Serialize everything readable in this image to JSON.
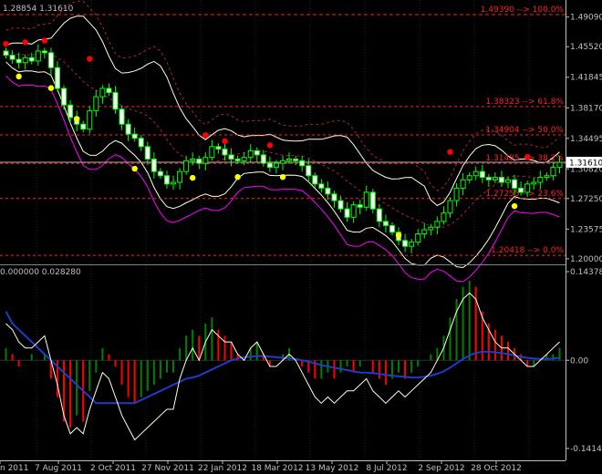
{
  "chart_data": [
    {
      "type": "candlestick",
      "panel": "price",
      "header": "1.28854 1.31610",
      "yticks": [
        "1.49090",
        "1.45520",
        "1.41845",
        "1.38170",
        "1.34495",
        "1.30820",
        "1.27250",
        "1.23575",
        "1.20000"
      ],
      "current_price": "1.31610",
      "fib_levels": [
        {
          "label": "1.49390 --> 100.0%",
          "value": 1.4939
        },
        {
          "label": "1.38323 --> 61.8%",
          "value": 1.38323
        },
        {
          "label": "1.34904 --> 50.0%",
          "value": 1.34904
        },
        {
          "label": "1.31485 --> 38.2%",
          "value": 1.31485
        },
        {
          "label": "1.27255 --> 23.6%",
          "value": 1.27255
        },
        {
          "label": "1.20418 --> 0.0%",
          "value": 1.20418
        }
      ],
      "close": [
        1.445,
        1.44,
        1.436,
        1.442,
        1.438,
        1.45,
        1.448,
        1.43,
        1.405,
        1.385,
        1.37,
        1.362,
        1.356,
        1.378,
        1.395,
        1.405,
        1.4,
        1.38,
        1.362,
        1.35,
        1.345,
        1.335,
        1.32,
        1.305,
        1.3,
        1.29,
        1.292,
        1.305,
        1.318,
        1.32,
        1.315,
        1.322,
        1.335,
        1.332,
        1.325,
        1.32,
        1.318,
        1.322,
        1.33,
        1.325,
        1.315,
        1.31,
        1.315,
        1.318,
        1.32,
        1.318,
        1.312,
        1.3,
        1.29,
        1.285,
        1.278,
        1.27,
        1.26,
        1.25,
        1.265,
        1.262,
        1.28,
        1.26,
        1.245,
        1.24,
        1.232,
        1.222,
        1.215,
        1.22,
        1.23,
        1.235,
        1.238,
        1.245,
        1.255,
        1.27,
        1.285,
        1.295,
        1.3,
        1.305,
        1.298,
        1.295,
        1.298,
        1.292,
        1.295,
        1.285,
        1.28,
        1.29,
        1.292,
        1.298,
        1.3,
        1.31,
        1.316
      ],
      "up_fractals": [
        [
          0,
          1.452
        ],
        [
          3,
          1.454
        ],
        [
          6,
          1.456
        ],
        [
          13,
          1.434
        ],
        [
          31,
          1.342
        ],
        [
          34,
          1.335
        ],
        [
          41,
          1.33
        ],
        [
          69,
          1.322
        ],
        [
          81,
          1.316
        ]
      ],
      "down_fractals": [
        [
          2,
          1.426
        ],
        [
          7,
          1.412
        ],
        [
          11,
          1.375
        ],
        [
          20,
          1.315
        ],
        [
          29,
          1.304
        ],
        [
          36,
          1.305
        ],
        [
          43,
          1.305
        ],
        [
          61,
          1.235
        ],
        [
          79,
          1.27
        ]
      ]
    },
    {
      "type": "histogram",
      "panel": "oscillator",
      "header": "0.000000 0.028280",
      "yticks": [
        "0.14378",
        "0.00",
        "-0.14145"
      ],
      "ylim": [
        -0.1441,
        0.1464
      ],
      "xticks": [
        "n 2011",
        "7 Aug 2011",
        "2 Oct 2011",
        "27 Nov 2011",
        "22 Jan 2012",
        "18 Mar 2012",
        "13 May 2012",
        "8 Jul 2012",
        "2 Sep 2012",
        "28 Oct 2012"
      ],
      "values": [
        0.02,
        0.01,
        -0.01,
        0.0,
        0.01,
        0.0,
        0.01,
        -0.03,
        -0.06,
        -0.1,
        -0.11,
        -0.09,
        -0.1,
        -0.05,
        -0.02,
        0.02,
        0.01,
        -0.01,
        -0.04,
        -0.06,
        -0.07,
        -0.06,
        -0.05,
        -0.04,
        -0.03,
        -0.02,
        -0.02,
        0.02,
        0.04,
        0.05,
        0.04,
        0.06,
        0.07,
        0.05,
        0.04,
        0.03,
        0.01,
        0.0,
        0.02,
        0.03,
        0.01,
        -0.01,
        0.0,
        0.01,
        0.02,
        0.0,
        -0.01,
        -0.02,
        -0.03,
        -0.03,
        -0.02,
        -0.03,
        -0.02,
        -0.01,
        -0.02,
        -0.01,
        0.0,
        -0.02,
        -0.03,
        -0.04,
        -0.03,
        -0.02,
        -0.03,
        -0.02,
        -0.01,
        0.0,
        0.01,
        0.02,
        0.04,
        0.07,
        0.1,
        0.12,
        0.13,
        0.12,
        0.08,
        0.06,
        0.05,
        0.04,
        0.03,
        0.02,
        0.01,
        -0.01,
        -0.01,
        0.0,
        0.01,
        0.01,
        0.02
      ],
      "signal_line": [
        0.08,
        0.06,
        0.05,
        0.04,
        0.03,
        0.02,
        0.01,
        0.0,
        -0.01,
        -0.02,
        -0.03,
        -0.04,
        -0.05,
        -0.06,
        -0.07,
        -0.07,
        -0.07,
        -0.07,
        -0.07,
        -0.07,
        -0.07,
        -0.065,
        -0.06,
        -0.055,
        -0.05,
        -0.045,
        -0.04,
        -0.035,
        -0.03,
        -0.028,
        -0.025,
        -0.02,
        -0.015,
        -0.01,
        -0.005,
        0.0,
        0.003,
        0.005,
        0.006,
        0.007,
        0.007,
        0.006,
        0.005,
        0.004,
        0.003,
        0.002,
        0.0,
        -0.002,
        -0.005,
        -0.008,
        -0.01,
        -0.012,
        -0.014,
        -0.016,
        -0.018,
        -0.02,
        -0.02,
        -0.021,
        -0.022,
        -0.024,
        -0.025,
        -0.026,
        -0.027,
        -0.028,
        -0.028,
        -0.027,
        -0.025,
        -0.022,
        -0.018,
        -0.012,
        -0.005,
        0.002,
        0.008,
        0.012,
        0.014,
        0.014,
        0.013,
        0.012,
        0.01,
        0.008,
        0.006,
        0.004,
        0.003,
        0.002,
        0.002,
        0.003,
        0.004
      ],
      "main_line": [
        0.06,
        0.05,
        0.03,
        0.02,
        0.02,
        0.03,
        0.04,
        0.0,
        -0.04,
        -0.09,
        -0.12,
        -0.11,
        -0.12,
        -0.08,
        -0.05,
        -0.02,
        -0.03,
        -0.06,
        -0.09,
        -0.11,
        -0.13,
        -0.12,
        -0.11,
        -0.1,
        -0.09,
        -0.08,
        -0.08,
        -0.03,
        0.0,
        0.02,
        0.0,
        0.03,
        0.05,
        0.04,
        0.03,
        0.03,
        0.01,
        0.0,
        0.02,
        0.03,
        0.01,
        -0.01,
        -0.01,
        0.0,
        0.01,
        0.0,
        -0.02,
        -0.04,
        -0.06,
        -0.07,
        -0.06,
        -0.07,
        -0.06,
        -0.05,
        -0.05,
        -0.04,
        -0.03,
        -0.05,
        -0.06,
        -0.07,
        -0.06,
        -0.05,
        -0.06,
        -0.05,
        -0.04,
        -0.03,
        -0.02,
        0.0,
        0.02,
        0.05,
        0.08,
        0.1,
        0.11,
        0.1,
        0.07,
        0.05,
        0.03,
        0.02,
        0.02,
        0.01,
        0.0,
        -0.01,
        -0.01,
        0.0,
        0.01,
        0.02,
        0.03
      ]
    }
  ],
  "colors": {
    "background": "#000000",
    "grid": "#262626",
    "axis": "#c0c0c0",
    "candle_up": "#000000",
    "candle_down": "#ffffff",
    "candle_outline": "#00ff00",
    "fib_line": "#ff2020",
    "fib_text": "#ff2020",
    "band_inner": "#ffffe0",
    "band_outer": "#a52a2a",
    "magenta": "#ff00ff",
    "up_fractal": "#ff0000",
    "down_fractal": "#ffff00",
    "hist_up": "#008000",
    "hist_down": "#ff0000",
    "line_main": "#ffffe0",
    "line_signal": "#1e3cc8"
  }
}
